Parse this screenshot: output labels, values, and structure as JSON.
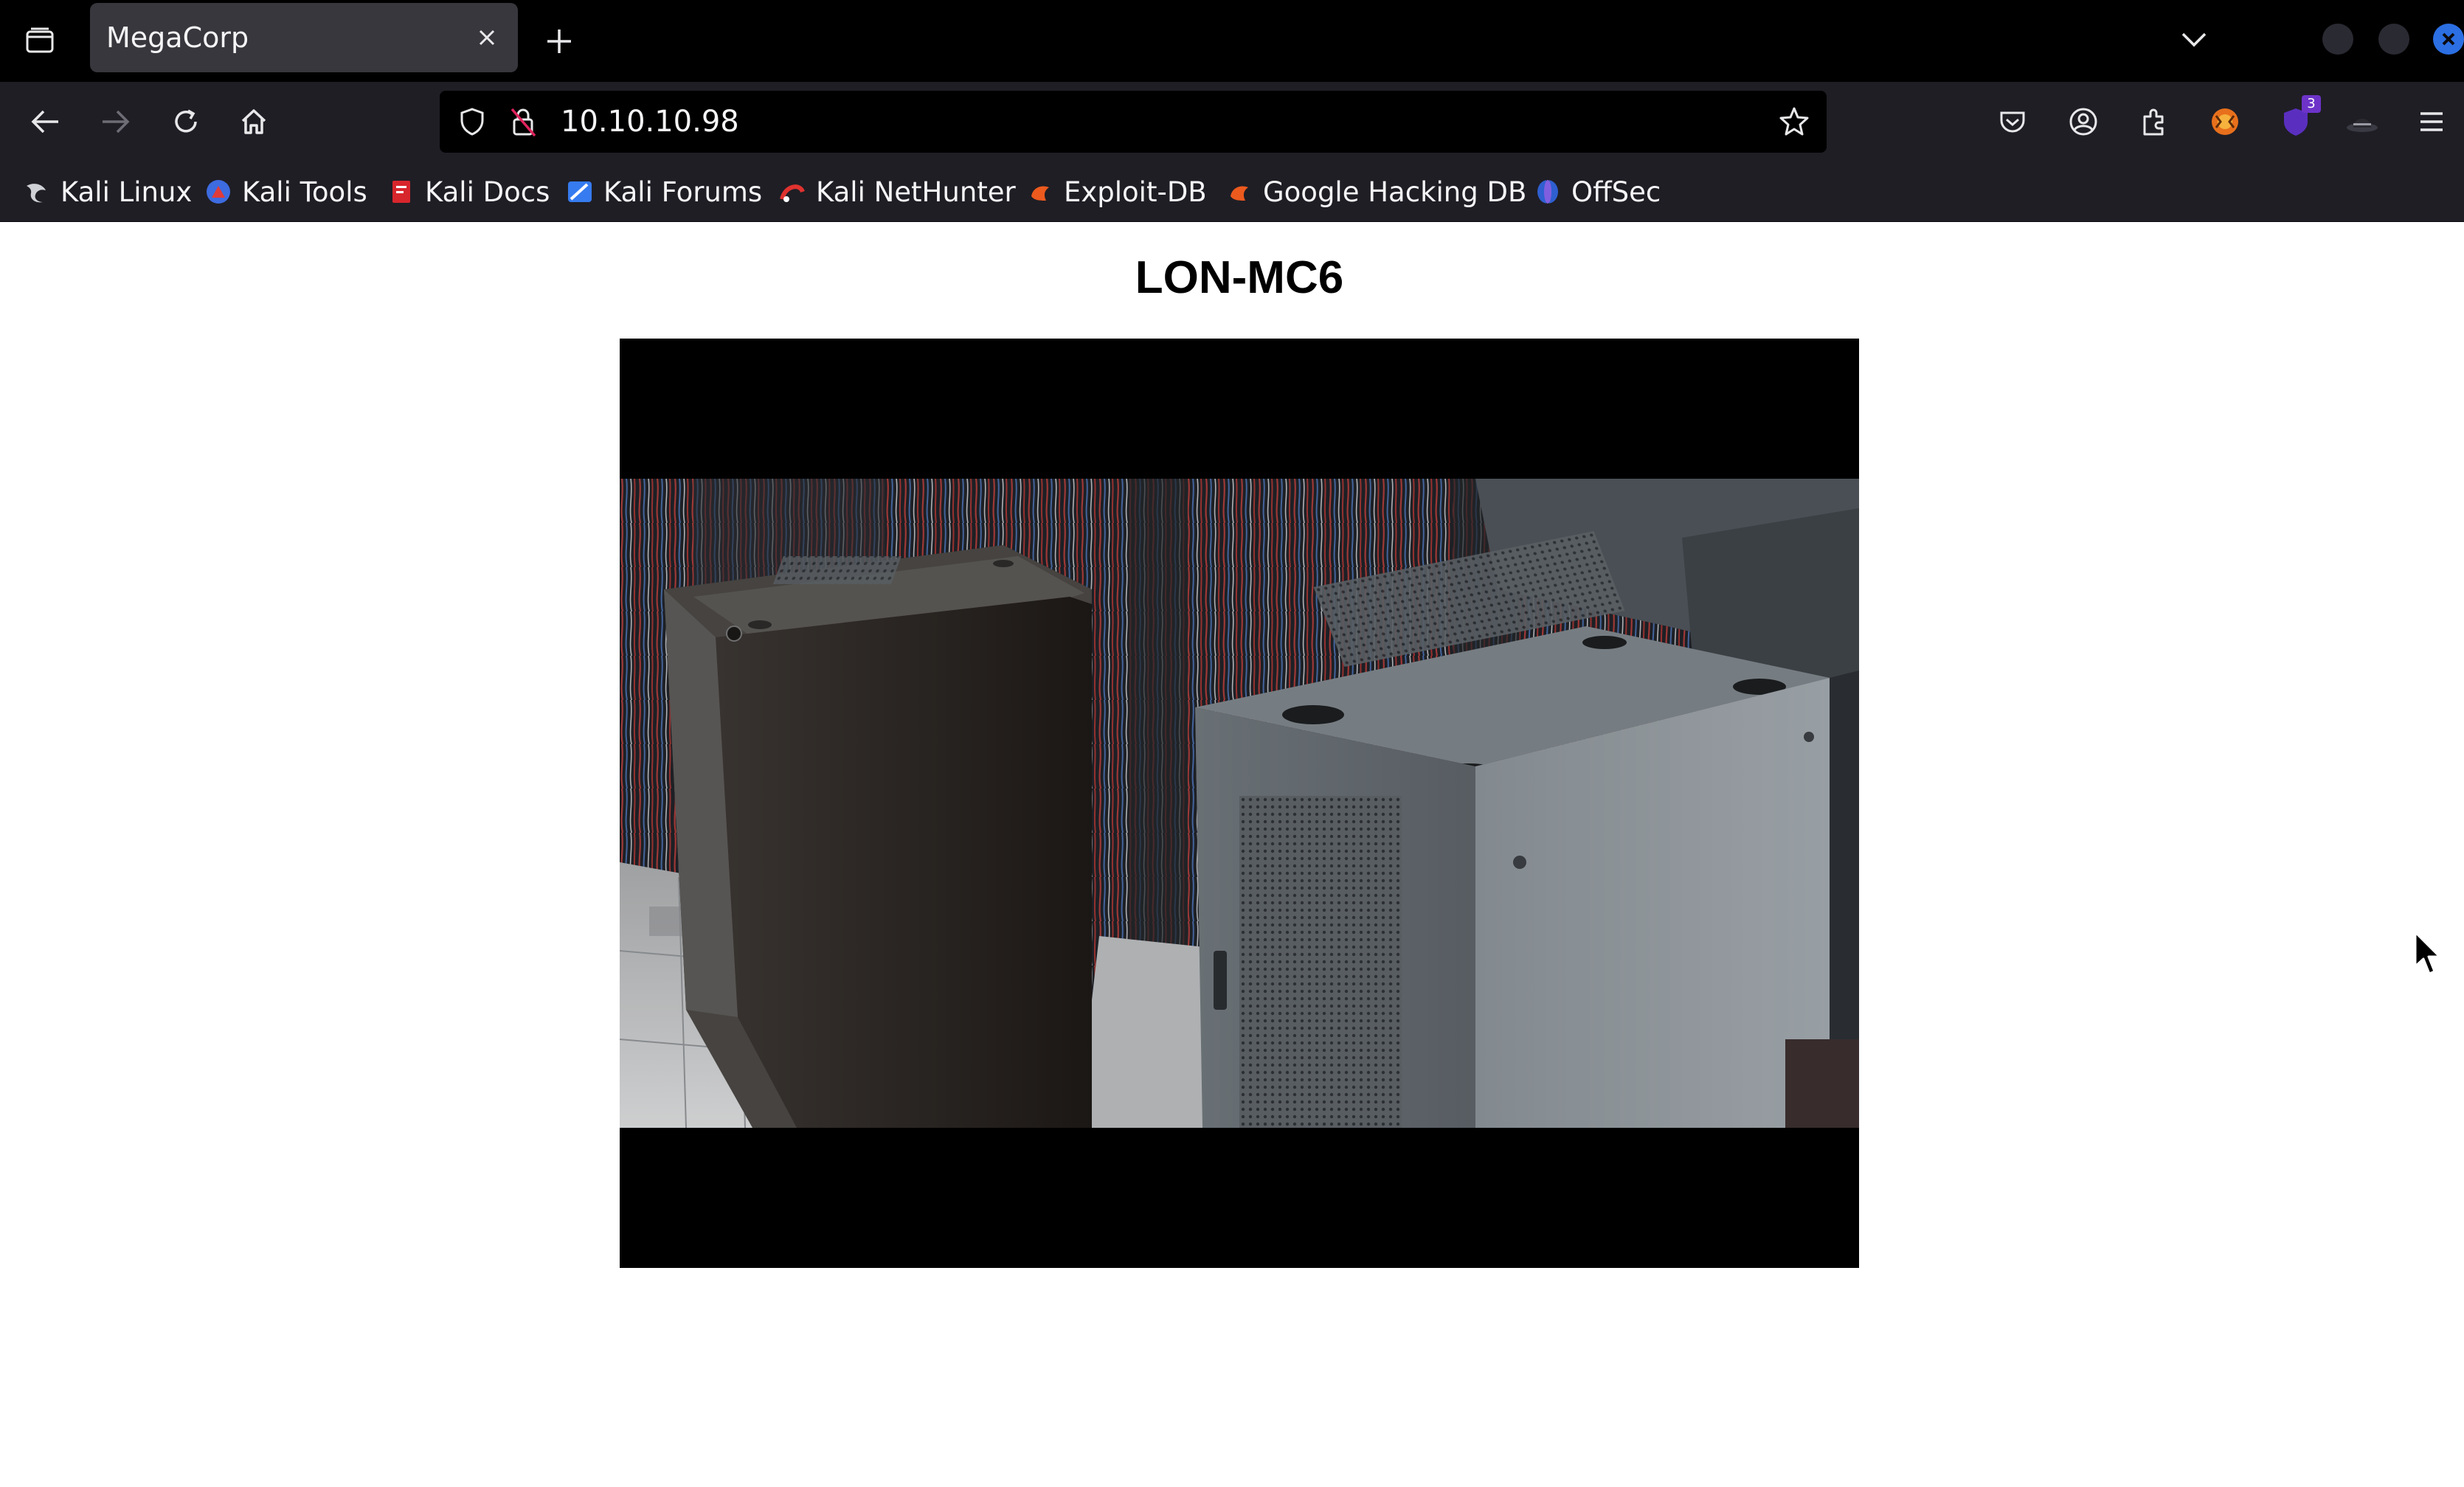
{
  "tabs": [
    {
      "title": "MegaCorp",
      "active": true
    }
  ],
  "navigation": {
    "url": "10.10.10.98",
    "extension_badge": "3"
  },
  "bookmarks": [
    {
      "label": "Kali Linux",
      "icon": "kali-dragon-icon"
    },
    {
      "label": "Kali Tools",
      "icon": "kali-tools-icon"
    },
    {
      "label": "Kali Docs",
      "icon": "kali-docs-icon"
    },
    {
      "label": "Kali Forums",
      "icon": "kali-forums-icon"
    },
    {
      "label": "Kali NetHunter",
      "icon": "kali-nethunter-icon"
    },
    {
      "label": "Exploit-DB",
      "icon": "exploit-db-icon"
    },
    {
      "label": "Google Hacking DB",
      "icon": "ghdb-icon"
    },
    {
      "label": "OffSec",
      "icon": "offsec-icon"
    }
  ],
  "page": {
    "camera_name": "LON-MC6"
  },
  "colors": {
    "tabstrip_bg": "#000000",
    "toolbar_bg": "#1f1e25",
    "active_tab_bg": "#38373d",
    "accent_blue": "#2b6fe3",
    "badge_purple": "#6d33c9"
  }
}
